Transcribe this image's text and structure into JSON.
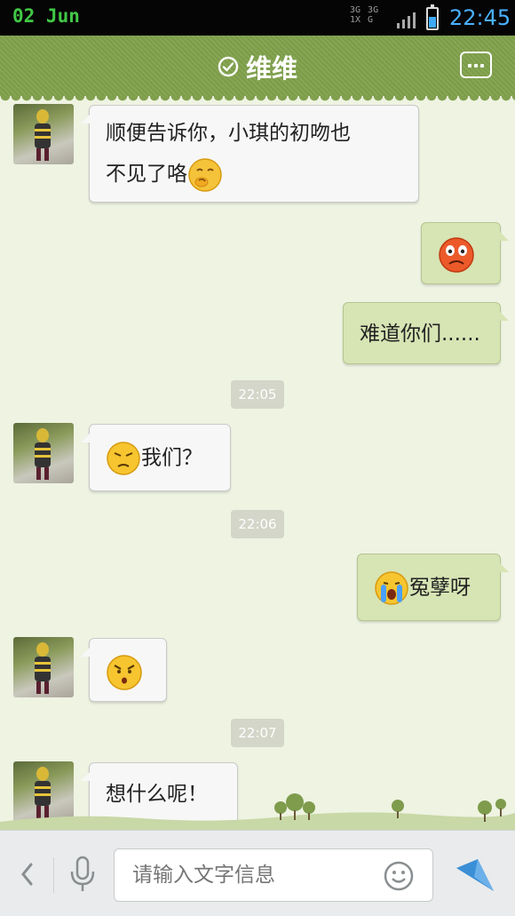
{
  "status_bar": {
    "date": "02 Jun",
    "network": "3G 3G 1X G",
    "time": "22:45",
    "battery_level": 0.55
  },
  "header": {
    "title": "维维",
    "online_icon": "check-circle-icon",
    "menu_icon": "more-dots-icon"
  },
  "messages": [
    {
      "side": "left",
      "lines": [
        "顺便告诉你，小琪的初吻也",
        "不见了咯"
      ],
      "emoji": "shy-face"
    },
    {
      "side": "right",
      "emoji": "shocked-red-face"
    },
    {
      "side": "right",
      "text": "难道你们......"
    },
    {
      "timestamp": "22:05"
    },
    {
      "side": "left",
      "emoji": "pouting-face",
      "text": "我们？"
    },
    {
      "timestamp": "22:06"
    },
    {
      "side": "right",
      "emoji": "crying-face",
      "text": "冤孽呀"
    },
    {
      "side": "left",
      "emoji": "angry-face"
    },
    {
      "timestamp": "22:07"
    },
    {
      "side": "left",
      "text": "想什么呢！"
    }
  ],
  "input_bar": {
    "placeholder": "请输入文字信息",
    "back_icon": "chevron-left-icon",
    "mic_icon": "microphone-icon",
    "emoji_icon": "smiley-icon",
    "send_icon": "send-arrow-icon"
  },
  "colors": {
    "header_green": "#7c9c4a",
    "chat_bg": "#eef3e2",
    "right_bubble": "#d7e4b4",
    "time_blue": "#4ab0ff"
  }
}
